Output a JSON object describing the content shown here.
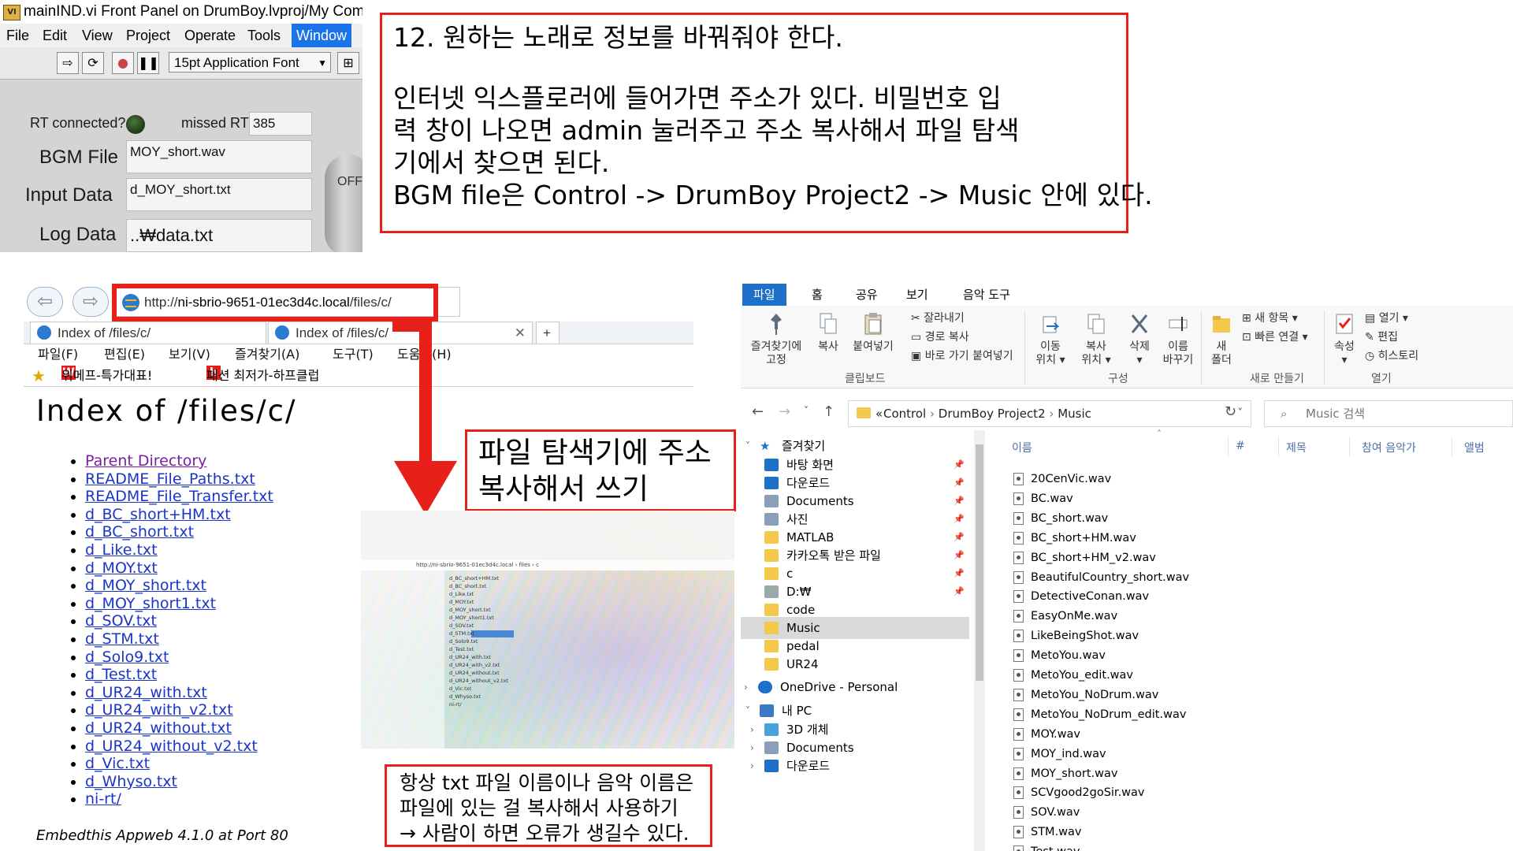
{
  "labview": {
    "title": "mainIND.vi Front Panel on DrumBoy.lvproj/My Comp",
    "icon_text": "VI",
    "menu": [
      "File",
      "Edit",
      "View",
      "Project",
      "Operate",
      "Tools",
      "Window"
    ],
    "font_select": "15pt Application Font",
    "rt_connected_label": "RT connected?",
    "missed_rt_label": "missed RT",
    "missed_rt_value": "385",
    "bgm_label": "BGM File",
    "bgm_value": "MOY_short.wav",
    "input_label": "Input Data",
    "input_value": "d_MOY_short.txt",
    "log_label": "Log Data",
    "log_value": "..₩data.txt",
    "switch_label": "OFF"
  },
  "callout_main": {
    "line1": "12.  원하는 노래로 정보를 바꿔줘야 한다.",
    "line2": "인터넷 익스플로러에 들어가면 주소가 있다. 비밀번호 입",
    "line3": "력 창이 나오면 admin 눌러주고 주소 복사해서 파일 탐색",
    "line4": "기에서 찾으면 된다.",
    "line5": "BGM file은  Control -> DrumBoy Project2 -> Music 안에 있다."
  },
  "callout_explorer": {
    "line1": "파일 탐색기에 주소",
    "line2": "복사해서 쓰기"
  },
  "callout_note": {
    "line1": "항상 txt 파일 이름이나 음악 이름은",
    "line2": "파일에 있는 걸 복사해서 사용하기",
    "line3": "→ 사람이 하면 오류가 생길수 있다."
  },
  "browser": {
    "url_prefix": "http://",
    "url_host": "ni-sbrio-9651-01ec3d4c.local",
    "url_path": "/files/c/",
    "tab1": "Index of /files/c/",
    "tab2": "Index of /files/c/",
    "tab_close": "✕",
    "menu": [
      "파일(F)",
      "편집(E)",
      "보기(V)",
      "즐겨찾기(A)",
      "도구(T)",
      "도움말(H)"
    ],
    "fav1_icon": "W",
    "fav1": "위메프-특가대표!",
    "fav2_icon": "h",
    "fav2": "패션 최저가-하프클럽",
    "page_title": "Index of /files/c/",
    "links": [
      "Parent Directory",
      "README_File_Paths.txt",
      "README_File_Transfer.txt",
      "d_BC_short+HM.txt",
      "d_BC_short.txt",
      "d_Like.txt",
      "d_MOY.txt",
      "d_MOY_short.txt",
      "d_MOY_short1.txt",
      "d_SOV.txt",
      "d_STM.txt",
      "d_Solo9.txt",
      "d_Test.txt",
      "d_UR24_with.txt",
      "d_UR24_with_v2.txt",
      "d_UR24_without.txt",
      "d_UR24_without_v2.txt",
      "d_Vic.txt",
      "d_Whyso.txt",
      "ni-rt/"
    ],
    "footer": "Embedthis Appweb 4.1.0 at Port 80"
  },
  "explorer": {
    "ribbon_tabs": [
      "파일",
      "홈",
      "공유",
      "보기",
      "음악 도구"
    ],
    "ribbon": {
      "pin": "즐겨찾기에",
      "pin2": "고정",
      "copy": "복사",
      "paste": "붙여넣기",
      "cut": "잘라내기",
      "copy_path": "경로 복사",
      "paste_shortcut": "바로 가기 붙여넣기",
      "move_to": "이동",
      "move_to2": "위치",
      "copy_to": "복사",
      "copy_to2": "위치",
      "delete": "삭제",
      "rename": "이름",
      "rename2": "바꾸기",
      "new_folder": "새",
      "new_folder2": "폴더",
      "new_item": "새 항목",
      "easy_access": "빠른 연결",
      "properties": "속성",
      "open": "열기",
      "edit": "편집",
      "history": "히스토리",
      "group_clipboard": "클립보드",
      "group_organize": "구성",
      "group_new": "새로 만들기",
      "group_open": "열기"
    },
    "breadcrumb": [
      "Control",
      "DrumBoy Project2",
      "Music"
    ],
    "search_placeholder": "Music 검색",
    "nav": [
      {
        "label": "즐겨찾기",
        "icon": "star-icon",
        "pinned": false
      },
      {
        "label": "바탕 화면",
        "icon": "desktop-icon",
        "pinned": true
      },
      {
        "label": "다운로드",
        "icon": "download-icon",
        "pinned": true
      },
      {
        "label": "Documents",
        "icon": "document-icon",
        "pinned": true
      },
      {
        "label": "사진",
        "icon": "pictures-icon",
        "pinned": true
      },
      {
        "label": "MATLAB",
        "icon": "folder-icon",
        "pinned": true
      },
      {
        "label": "카카오톡 받은 파일",
        "icon": "folder-icon",
        "pinned": true
      },
      {
        "label": "c",
        "icon": "folder-icon",
        "pinned": true
      },
      {
        "label": "D:₩",
        "icon": "drive-icon",
        "pinned": true
      },
      {
        "label": "code",
        "icon": "folder-icon",
        "pinned": false
      },
      {
        "label": "Music",
        "icon": "folder-icon",
        "pinned": false
      },
      {
        "label": "pedal",
        "icon": "folder-icon",
        "pinned": false
      },
      {
        "label": "UR24",
        "icon": "folder-icon",
        "pinned": false
      },
      {
        "label": "OneDrive - Personal",
        "icon": "cloud-icon",
        "pinned": false
      },
      {
        "label": "내 PC",
        "icon": "pc-icon",
        "pinned": false
      },
      {
        "label": "3D 개체",
        "icon": "3d-objects-icon",
        "pinned": false
      },
      {
        "label": "Documents",
        "icon": "document-icon",
        "pinned": false
      },
      {
        "label": "다운로드",
        "icon": "download-icon",
        "pinned": false
      }
    ],
    "columns": [
      "이름",
      "#",
      "제목",
      "참여 음악가",
      "앨범"
    ],
    "files": [
      "20CenVic.wav",
      "BC.wav",
      "BC_short.wav",
      "BC_short+HM.wav",
      "BC_short+HM_v2.wav",
      "BeautifulCountry_short.wav",
      "DetectiveConan.wav",
      "EasyOnMe.wav",
      "LikeBeingShot.wav",
      "MetoYou.wav",
      "MetoYou_edit.wav",
      "MetoYou_NoDrum.wav",
      "MetoYou_NoDrum_edit.wav",
      "MOY.wav",
      "MOY_ind.wav",
      "MOY_short.wav",
      "SCVgood2goSir.wav",
      "SOV.wav",
      "STM.wav",
      "Test.wav"
    ]
  },
  "colors": {
    "callout_red": "#e8201a",
    "link_blue": "#1a35c8",
    "visited_purple": "#7b1fa2",
    "explorer_accent": "#1e6fc8",
    "folder_yellow": "#f3c94c"
  }
}
